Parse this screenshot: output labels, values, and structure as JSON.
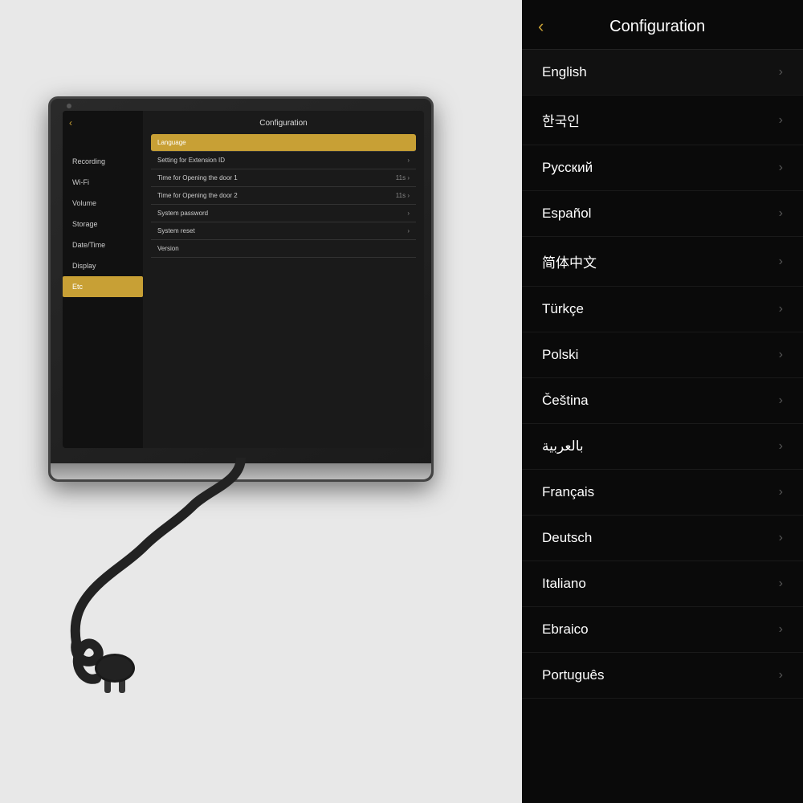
{
  "background": {
    "color": "#e8e8e8"
  },
  "device": {
    "screen": {
      "back_button": "‹",
      "title": "Configuration",
      "sidebar_items": [
        {
          "label": "Recording",
          "active": false
        },
        {
          "label": "Wi-Fi",
          "active": false
        },
        {
          "label": "Volume",
          "active": false
        },
        {
          "label": "Storage",
          "active": false
        },
        {
          "label": "Date/Time",
          "active": false
        },
        {
          "label": "Display",
          "active": false
        },
        {
          "label": "Etc",
          "active": true
        }
      ],
      "menu_items": [
        {
          "label": "Language",
          "value": "",
          "highlighted": true,
          "has_chevron": false
        },
        {
          "label": "Setting for Extension ID",
          "value": "",
          "highlighted": false,
          "has_chevron": true
        },
        {
          "label": "Time for Opening the door 1",
          "value": "11s",
          "highlighted": false,
          "has_chevron": true
        },
        {
          "label": "Time for Opening the door 2",
          "value": "11s",
          "highlighted": false,
          "has_chevron": true
        },
        {
          "label": "System  password",
          "value": "",
          "highlighted": false,
          "has_chevron": true
        },
        {
          "label": "System reset",
          "value": "",
          "highlighted": false,
          "has_chevron": true
        },
        {
          "label": "Version",
          "value": "",
          "highlighted": false,
          "has_chevron": false
        }
      ]
    }
  },
  "phone_panel": {
    "back_button": "‹",
    "title": "Configuration",
    "languages": [
      {
        "name": "English"
      },
      {
        "name": "한국인"
      },
      {
        "name": "Русский"
      },
      {
        "name": "Español"
      },
      {
        "name": "简体中文"
      },
      {
        "name": "Türkçe"
      },
      {
        "name": "Polski"
      },
      {
        "name": "Čeština"
      },
      {
        "name": "بالعربية"
      },
      {
        "name": "Français"
      },
      {
        "name": "Deutsch"
      },
      {
        "name": "Italiano"
      },
      {
        "name": "Ebraico"
      },
      {
        "name": "Português"
      }
    ]
  }
}
